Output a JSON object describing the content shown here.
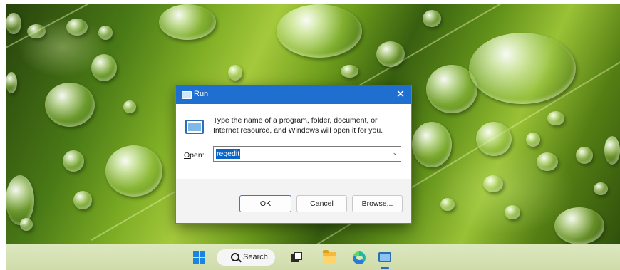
{
  "dialog": {
    "title": "Run",
    "close_glyph": "✕",
    "description": "Type the name of a program, folder, document, or Internet resource, and Windows will open it for you.",
    "open_label_accel": "O",
    "open_label_rest": "pen:",
    "input_value": "regedit",
    "dropdown_glyph": "⌄",
    "buttons": {
      "ok": "OK",
      "cancel": "Cancel",
      "browse_accel": "B",
      "browse_rest": "rowse..."
    }
  },
  "taskbar": {
    "search_label": "Search",
    "icons": [
      "windows-start-icon",
      "search-icon",
      "task-view-icon",
      "file-explorer-icon",
      "edge-icon",
      "run-app-icon"
    ]
  },
  "colors": {
    "titlebar": "#1f6fd1",
    "selection": "#0a64c8",
    "windows_blue": "#1a84e0"
  }
}
